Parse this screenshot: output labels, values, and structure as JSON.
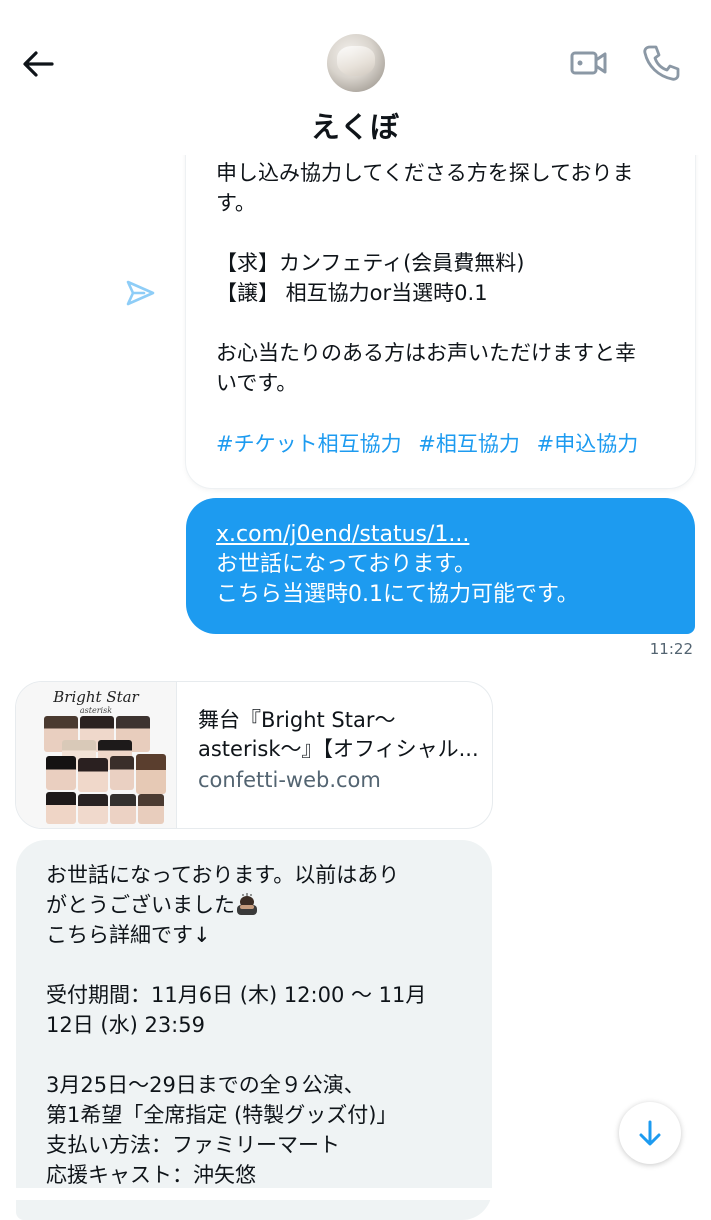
{
  "header": {
    "contact_name": "えくぼ",
    "icons": [
      "back-arrow-icon",
      "avatar",
      "video-camera-icon",
      "phone-icon"
    ]
  },
  "messages": {
    "top_message": {
      "text": "申し込み協力してくださる方を探しておりま\nす。\n\n【求】カンフェティ(会員費無料)\n【譲】 相互協力or当選時0.1\n\nお心当たりのある方はお声いただけますと幸\nいです。",
      "hashtags": [
        "#チケット相互協力",
        "#相互協力",
        "#申込協力"
      ]
    },
    "sent_message": {
      "link": "x.com/j0end/status/1...",
      "text": "お世話になっております。\nこちら当選時0.1にて協力可能です。",
      "timestamp": "11:22"
    },
    "link_card": {
      "thumb_logo": "Bright Star",
      "thumb_sub": "asterisk",
      "title": "舞台『Bright Star～\nasterisk～』【オフィシャル...",
      "domain": "confetti-web.com"
    },
    "received_message": {
      "line1": "お世話になっております。以前はあり",
      "line2": "がとうございました",
      "rest": "こちら詳細です↓\n\n受付期間：11月6日 (木) 12:00 ～ 11月\n12日 (水) 23:59\n\n3月25日～29日までの全９公演、\n第1希望「全席指定 (特製グッズ付)」\n支払い方法：ファミリーマート\n応援キャスト：沖矢悠"
    }
  },
  "colors": {
    "accent": "#1d9bf0",
    "received_bubble": "#eff3f4",
    "secondary_text": "#536471"
  }
}
